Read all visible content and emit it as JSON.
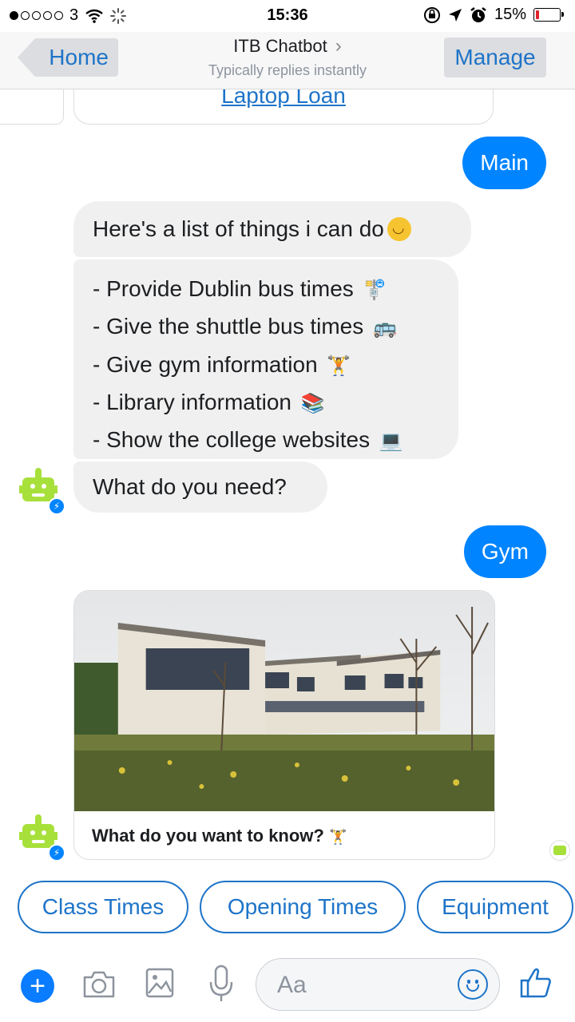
{
  "status_bar": {
    "carrier": "3",
    "time": "15:36",
    "battery_percent": "15%",
    "battery_level": 0.15,
    "icons": [
      "signal-dots",
      "wifi-icon",
      "activity-icon",
      "rotation-lock-icon",
      "location-icon",
      "alarm-icon",
      "battery-icon"
    ]
  },
  "header": {
    "back_label": "Home",
    "title": "ITB Chatbot",
    "subtitle": "Typically replies instantly",
    "manage_label": "Manage"
  },
  "messages": {
    "previous_card_link": "Laptop Loan",
    "user_main": "Main",
    "bot_intro": "Here's a list of things i can do",
    "bot_list": [
      "- Provide Dublin bus times",
      "- Give the shuttle bus times",
      "- Give gym information",
      "- Library information",
      "- Show the college websites"
    ],
    "bot_question": "What do you need?",
    "user_gym": "Gym",
    "card_caption": "What do you want to know?"
  },
  "quick_replies": [
    "Class Times",
    "Opening Times",
    "Equipment"
  ],
  "composer": {
    "placeholder": "Aa",
    "icons": [
      "plus-icon",
      "camera-icon",
      "image-icon",
      "microphone-icon",
      "emoji-icon",
      "thumbs-up-icon"
    ]
  },
  "colors": {
    "accent": "#0084ff",
    "link": "#1e74c8",
    "bot_bubble": "#f0f0f0",
    "bot_avatar": "#a8e03b",
    "battery_low": "#e0242c"
  }
}
